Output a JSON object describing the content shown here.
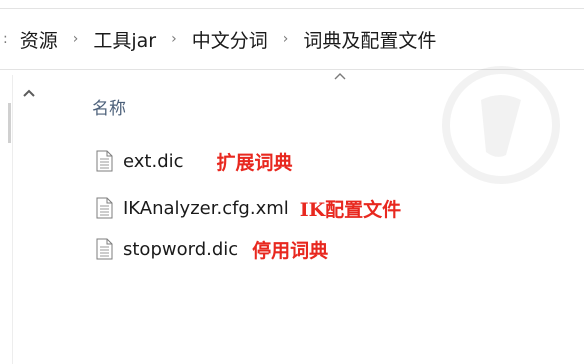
{
  "breadcrumb": {
    "lead_glyph": ":",
    "items": [
      "资源",
      "工具jar",
      "中文分词",
      "词典及配置文件"
    ],
    "separator": "›"
  },
  "column_header": {
    "name_label": "名称"
  },
  "files": [
    {
      "name": "ext.dic",
      "note": "扩展词典"
    },
    {
      "name": "IKAnalyzer.cfg.xml",
      "note": "IK配置文件"
    },
    {
      "name": "stopword.dic",
      "note": "停用词典"
    }
  ],
  "colors": {
    "annotation": "#e8281f",
    "header_text": "#4c607a",
    "file_text": "#1a1a1a"
  },
  "icons": {
    "file": "document-icon",
    "sort": "sort-up-icon",
    "scroll": "scroll-up-icon"
  }
}
